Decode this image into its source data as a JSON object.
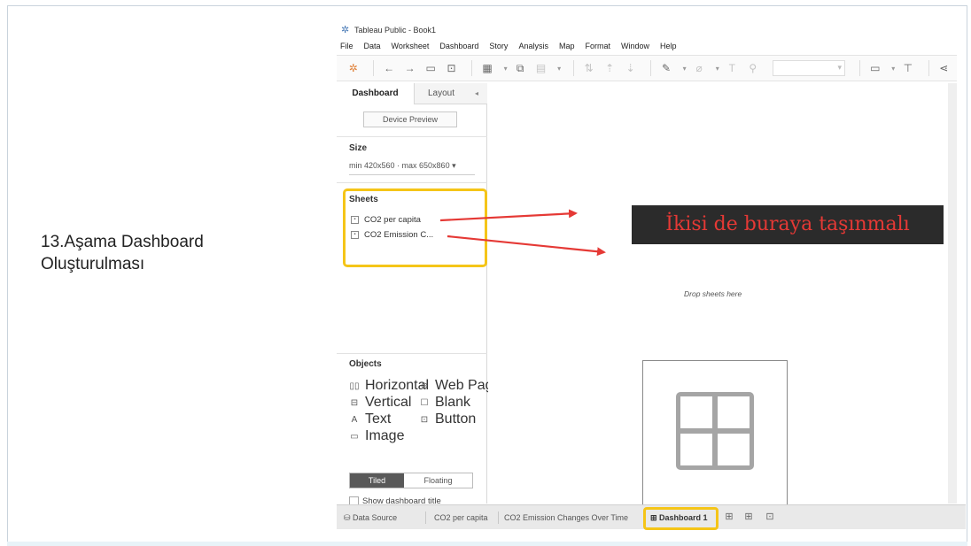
{
  "slide": {
    "step_title_line1": "13.Aşama Dashboard",
    "step_title_line2": "Oluşturulması"
  },
  "app": {
    "title": "Tableau Public - Book1",
    "menu": [
      "File",
      "Data",
      "Worksheet",
      "Dashboard",
      "Story",
      "Analysis",
      "Map",
      "Format",
      "Window",
      "Help"
    ]
  },
  "left_panel": {
    "tab_dashboard": "Dashboard",
    "tab_layout": "Layout",
    "device_preview": "Device Preview",
    "size_title": "Size",
    "size_value": "min 420x560 · max 650x860 ▾",
    "sheets_title": "Sheets",
    "sheets": [
      "CO2 per capita",
      "CO2 Emission C..."
    ],
    "objects_title": "Objects",
    "objects": {
      "horizontal": "Horizontal",
      "vertical": "Vertical",
      "text": "Text",
      "image": "Image",
      "web_page": "Web Page",
      "blank": "Blank",
      "button": "Button"
    },
    "tiled": "Tiled",
    "floating": "Floating",
    "show_title": "Show dashboard title"
  },
  "canvas": {
    "drop_text": "Drop sheets here",
    "callout": "İkisi de buraya taşınmalı"
  },
  "bottom_tabs": {
    "data_source": "Data Source",
    "sheet1": "CO2 per capita",
    "sheet2": "CO2 Emission Changes Over Time",
    "dashboard": "Dashboard 1"
  },
  "colors": {
    "highlight": "#f5c518",
    "arrow": "#e53935",
    "callout_bg": "#2b2b2b",
    "callout_text": "#e53935"
  }
}
